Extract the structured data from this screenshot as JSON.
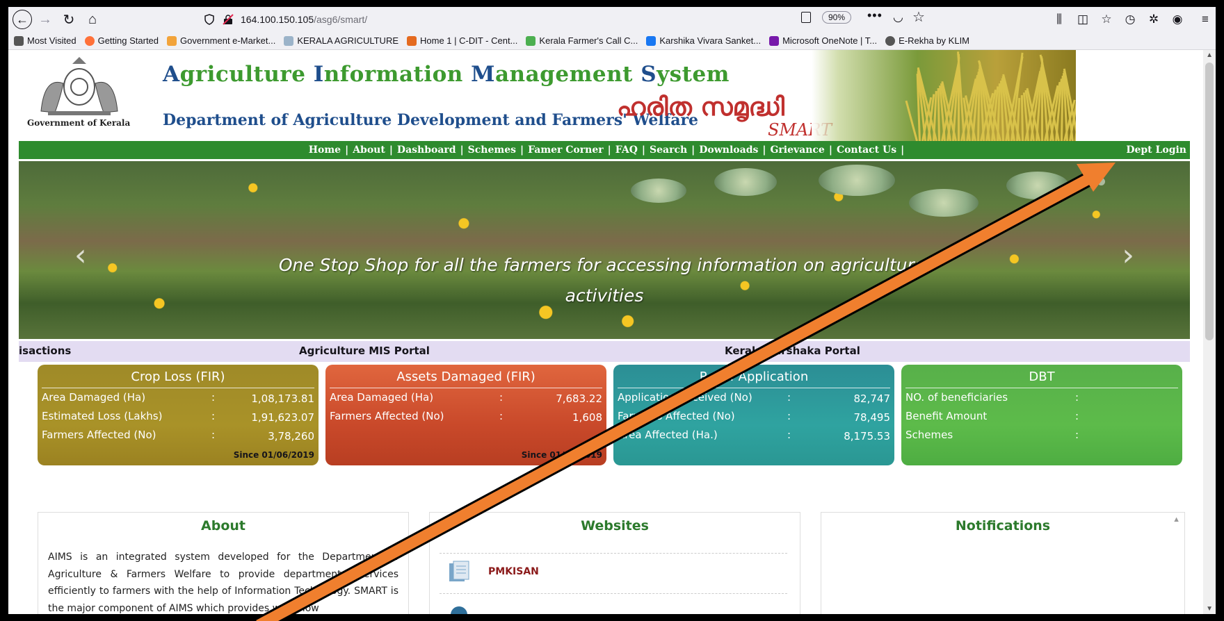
{
  "browser": {
    "url_host": "164.100.150.105",
    "url_path": "/asg6/smart/",
    "zoom": "90%",
    "bookmarks": [
      {
        "label": "Most Visited",
        "icon": "gear-icon",
        "color": "#555555"
      },
      {
        "label": "Getting Started",
        "icon": "firefox-icon",
        "color": "#ff7139"
      },
      {
        "label": "Government e-Market...",
        "icon": "gem-icon",
        "color": "#f2a33a"
      },
      {
        "label": "KERALA AGRICULTURE",
        "icon": "leaf-icon",
        "color": "#9bb3c9"
      },
      {
        "label": "Home 1 | C-DIT - Cent...",
        "icon": "cdit-icon",
        "color": "#e46a1f"
      },
      {
        "label": "Kerala Farmer's Call C...",
        "icon": "farmer-icon",
        "color": "#4caf50"
      },
      {
        "label": "Karshika Vivara Sanket...",
        "icon": "facebook-icon",
        "color": "#1877f2"
      },
      {
        "label": "Microsoft OneNote | T...",
        "icon": "onenote-icon",
        "color": "#7719aa"
      },
      {
        "label": "E-Rekha by KLIM",
        "icon": "globe-icon",
        "color": "#555555"
      }
    ]
  },
  "site": {
    "emblem_caption": "Government of Kerala",
    "title_parts": [
      "A",
      "griculture ",
      "I",
      "nformation ",
      "M",
      "anagement ",
      "S",
      "ystem"
    ],
    "subtitle": "Department of Agriculture Development and Farmers' Welfare",
    "malayalam": "ഹരിത സമൃദ്ധി",
    "smart": "SMART"
  },
  "nav": {
    "items": [
      "Home",
      "About",
      "Dashboard",
      "Schemes",
      "Famer Corner",
      "FAQ",
      "Search",
      "Downloads",
      "Grievance",
      "Contact Us"
    ],
    "dept_login": "Dept Login"
  },
  "slider": {
    "caption_line1": "One Stop Shop for all the farmers for accessing information on agricultural",
    "caption_line2": "activities",
    "prev": "‹",
    "next": "›",
    "active_index": 0,
    "count": 2
  },
  "ticker": {
    "items": [
      "isactions",
      "Agriculture MIS Portal",
      "Kerala Karshaka Portal"
    ]
  },
  "cards": {
    "crop": {
      "title": "Crop Loss (FIR)",
      "rows": [
        {
          "label": "Area Damaged (Ha)",
          "sep": ":",
          "value": "1,08,173.81"
        },
        {
          "label": "Estimated Loss (Lakhs)",
          "sep": ":",
          "value": "1,91,623.07"
        },
        {
          "label": "Farmers Affected (No)",
          "sep": ":",
          "value": "3,78,260"
        }
      ],
      "since": "Since 01/06/2019"
    },
    "assets": {
      "title": "Assets Damaged (FIR)",
      "rows": [
        {
          "label": "Area Damaged (Ha)",
          "sep": ":",
          "value": "7,683.22"
        },
        {
          "label": "Farmers Affected (No)",
          "sep": ":",
          "value": "1,608"
        }
      ],
      "since": "Since 01/06/2019"
    },
    "relief": {
      "title": "Relief Application",
      "rows": [
        {
          "label": "Application Received (No)",
          "sep": ":",
          "value": "82,747"
        },
        {
          "label": "Farmer's Affected (No)",
          "sep": ":",
          "value": "78,495"
        },
        {
          "label": "Area Affected (Ha.)",
          "sep": ":",
          "value": "8,175.53"
        }
      ]
    },
    "dbt": {
      "title": "DBT",
      "rows": [
        {
          "label": "NO. of beneficiaries",
          "sep": ":",
          "value": ""
        },
        {
          "label": "Benefit Amount",
          "sep": ":",
          "value": ""
        },
        {
          "label": "Schemes",
          "sep": ":",
          "value": ""
        }
      ]
    }
  },
  "panels": {
    "about": {
      "title": "About",
      "text": "AIMS is an integrated system developed for the Department of Agriculture & Farmers Welfare to provide departmental services efficiently to farmers with the help of Information Technology. SMART is the major component of AIMS which provides work flow"
    },
    "websites": {
      "title": "Websites",
      "items": [
        "PMKISAN",
        ""
      ]
    },
    "notifications": {
      "title": "Notifications"
    }
  },
  "colors": {
    "nav_green": "#2e8b2e",
    "title_blue": "#1f4e8c",
    "annotation_arrow": "#f07f2e"
  }
}
